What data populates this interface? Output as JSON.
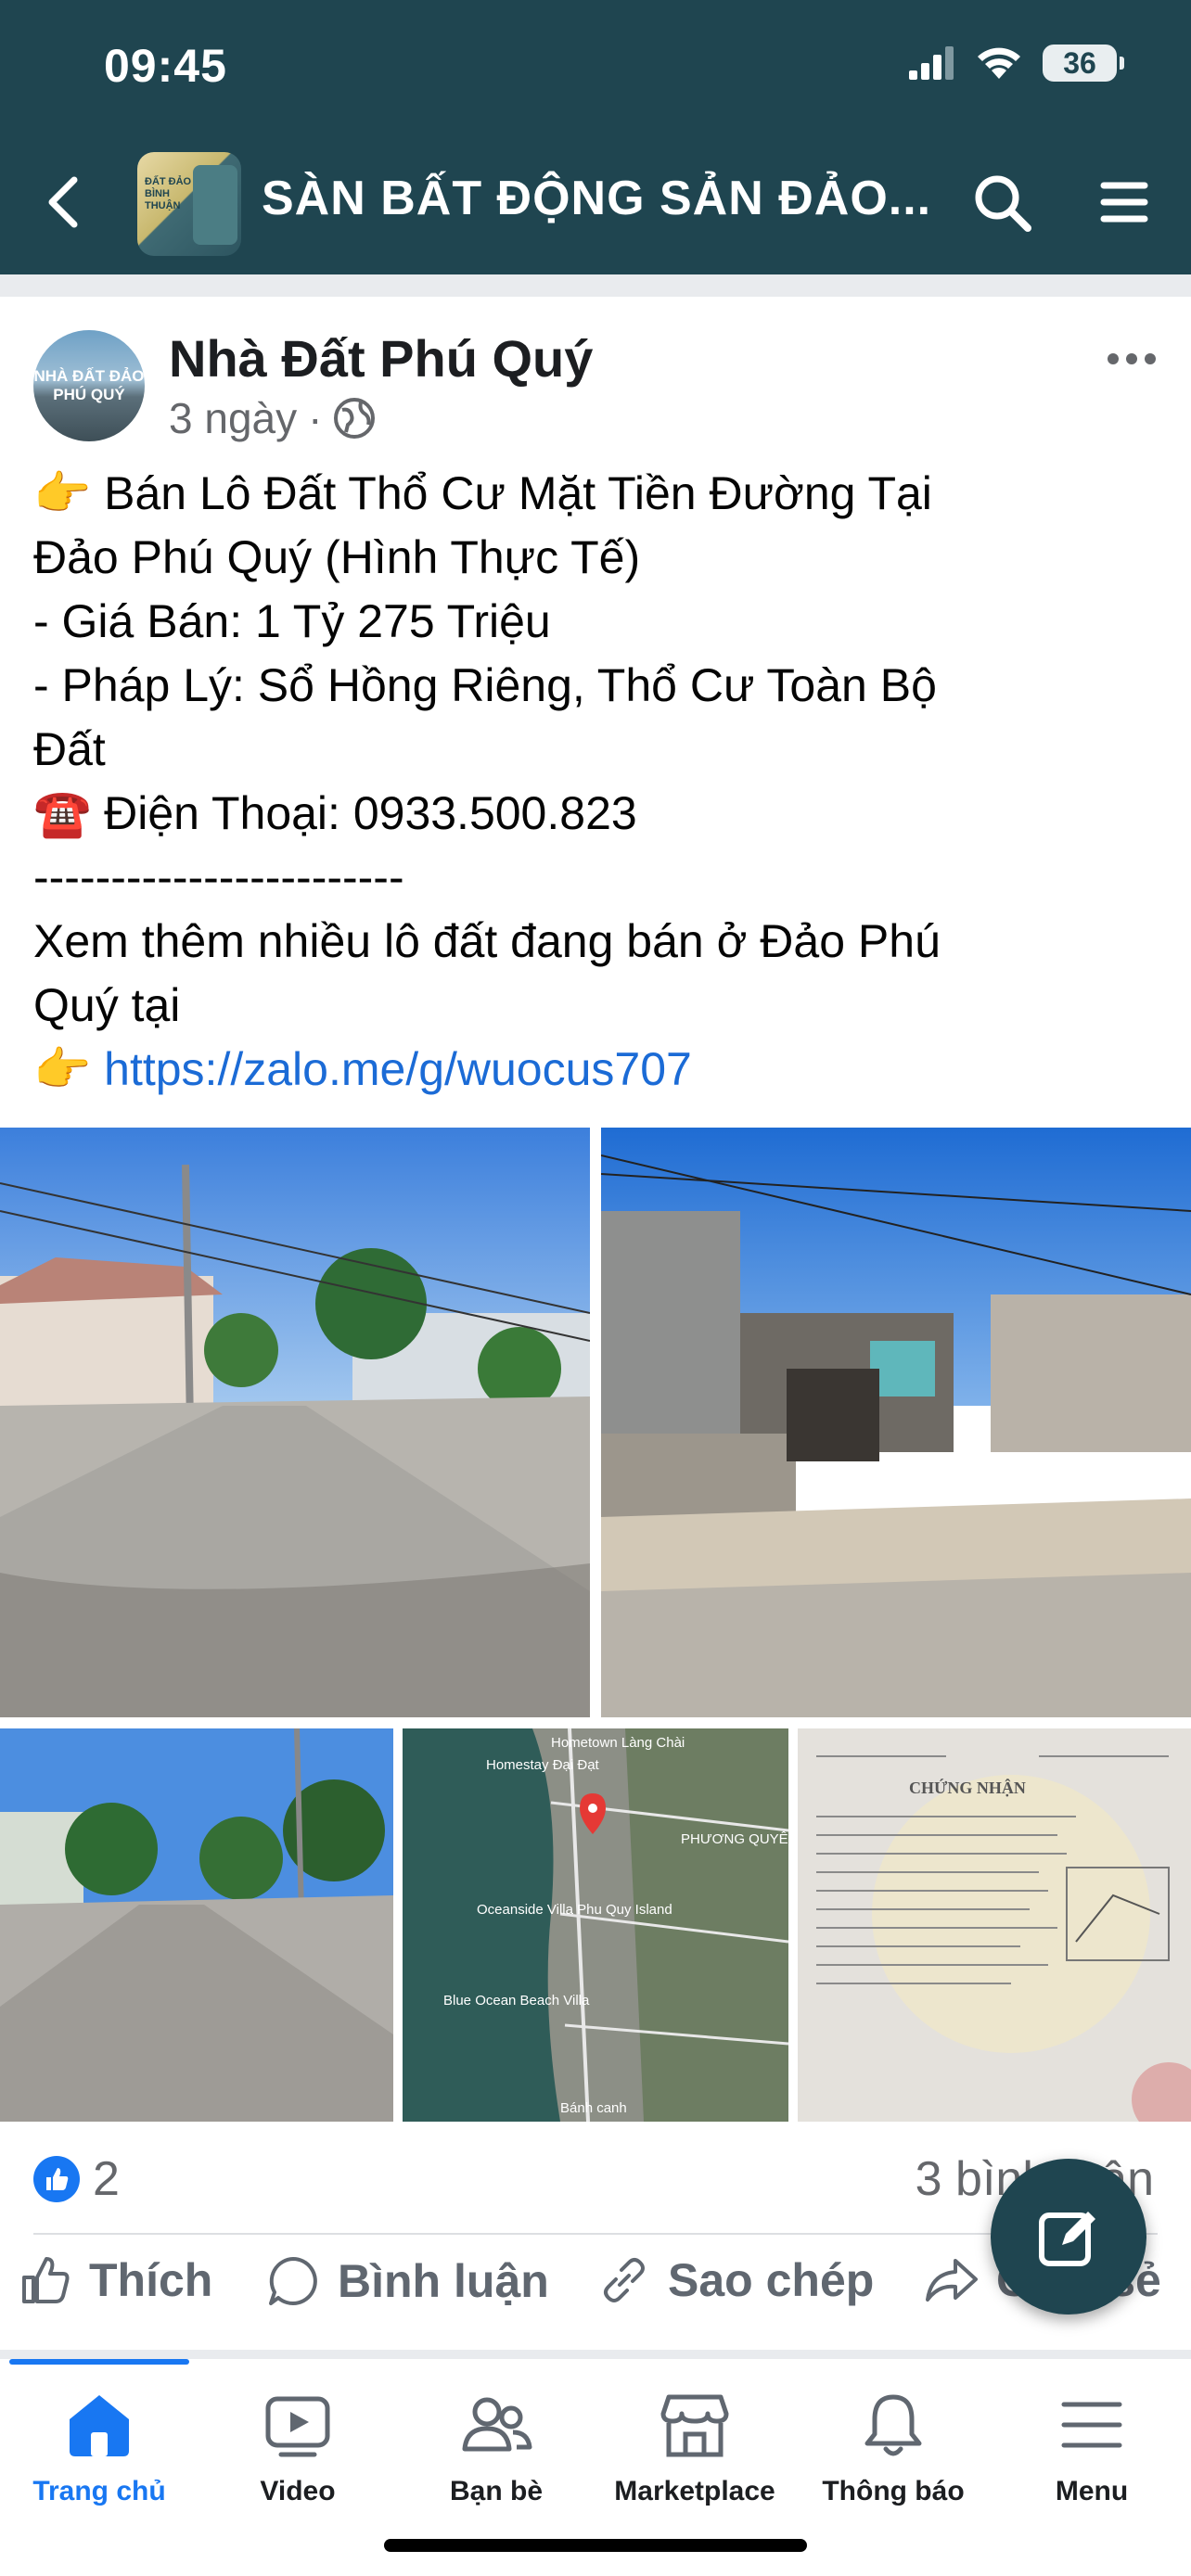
{
  "status_bar": {
    "time": "09:45",
    "battery": "36"
  },
  "header": {
    "title": "SÀN BẤT ĐỘNG SẢN ĐẢO...",
    "avatar_text": "ĐẤT ĐẢO BÌNH THUẬN"
  },
  "post": {
    "author": "Nhà Đất Phú Quý",
    "author_avatar_text": "NHÀ ĐẤT ĐẢO PHÚ QUÝ",
    "time": "3 ngày",
    "lines": [
      "👉 Bán Lô Đất Thổ Cư Mặt Tiền Đường Tại",
      "Đảo Phú Quý (Hình Thực Tế)",
      "- Giá Bán: 1 Tỷ 275 Triệu",
      "- Pháp Lý: Sổ Hồng Riêng, Thổ Cư Toàn Bộ",
      "Đất",
      "☎️ Điện Thoại: 0933.500.823",
      "------------------------",
      "Xem thêm nhiều lô đất đang bán ở Đảo Phú",
      "Quý tại"
    ],
    "link_prefix": "👉 ",
    "link": "https://zalo.me/g/wuocus707",
    "map_labels": {
      "homestay": "Homestay Đại Đạt",
      "oceanside": "Oceanside Villa Phu Quy Island",
      "blue_ocean": "Blue Ocean Beach Villa",
      "phuong_quyen": "PHƯƠNG QUYÊN",
      "hometown": "Hometown Làng Chài",
      "banh_canh": "Bánh canh"
    },
    "document_title": "CHỨNG NHẬN",
    "likes": "2",
    "comments": "3 bình luận"
  },
  "actions": {
    "like": "Thích",
    "comment": "Bình luận",
    "copy": "Sao chép",
    "share": "Chia sẻ"
  },
  "bottom_nav": {
    "home": "Trang chủ",
    "video": "Video",
    "friends": "Bạn bè",
    "marketplace": "Marketplace",
    "notifications": "Thông báo",
    "menu": "Menu"
  },
  "colors": {
    "header_bg": "#1f4550",
    "accent": "#1877f2",
    "link": "#1b6bd6"
  }
}
